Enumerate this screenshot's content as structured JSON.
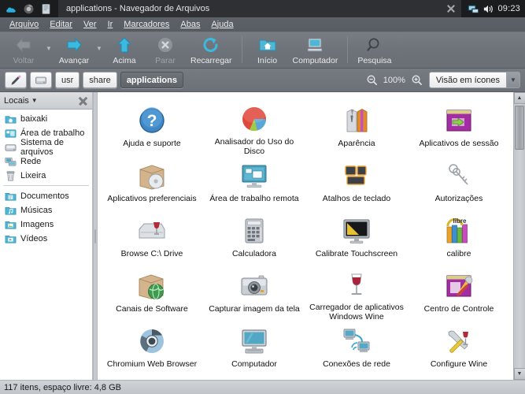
{
  "titlebar": {
    "launchers": [
      "cloud-icon",
      "browser-icon",
      "notes-icon"
    ],
    "window_title": "applications - Navegador de Arquivos",
    "close_label": "×",
    "tray": [
      "display-icon",
      "volume-icon"
    ],
    "clock": "09:23"
  },
  "menubar": {
    "items": [
      {
        "label": "Arquivo",
        "mnemonic": "A"
      },
      {
        "label": "Editar",
        "mnemonic": "E"
      },
      {
        "label": "Ver",
        "mnemonic": "V"
      },
      {
        "label": "Ir",
        "mnemonic": "I"
      },
      {
        "label": "Marcadores",
        "mnemonic": "M"
      },
      {
        "label": "Abas",
        "mnemonic": "b"
      },
      {
        "label": "Ajuda",
        "mnemonic": "u"
      }
    ]
  },
  "toolbar": {
    "buttons": [
      {
        "label": "Voltar",
        "icon": "arrow-left-icon",
        "enabled": false,
        "has_dropdown": true
      },
      {
        "label": "Avançar",
        "icon": "arrow-right-icon",
        "enabled": true,
        "has_dropdown": true
      },
      {
        "label": "Acima",
        "icon": "arrow-up-icon",
        "enabled": true,
        "has_dropdown": false
      },
      {
        "label": "Parar",
        "icon": "stop-icon",
        "enabled": false,
        "has_dropdown": false
      },
      {
        "label": "Recarregar",
        "icon": "reload-icon",
        "enabled": true,
        "has_dropdown": false
      },
      {
        "label": "Início",
        "icon": "home-folder-icon",
        "enabled": true,
        "has_dropdown": false
      },
      {
        "label": "Computador",
        "icon": "computer-icon",
        "enabled": true,
        "has_dropdown": false
      },
      {
        "label": "Pesquisa",
        "icon": "search-icon",
        "enabled": true,
        "has_dropdown": false
      }
    ]
  },
  "locationbar": {
    "edit_icon": "pencil-edit-icon",
    "root_icon": "harddrive-icon",
    "crumbs": [
      {
        "label": "usr",
        "current": false
      },
      {
        "label": "share",
        "current": false
      },
      {
        "label": "applications",
        "current": true
      }
    ],
    "zoom_out_icon": "zoom-out-icon",
    "zoom_level": "100%",
    "zoom_in_icon": "zoom-in-icon",
    "view_mode": "Visão em ícones",
    "view_caret": "▼"
  },
  "sidebar": {
    "title": "Locais",
    "caret": "▼",
    "close_label": "×",
    "groups": [
      {
        "items": [
          {
            "label": "baixaki",
            "icon": "home-folder-icon"
          },
          {
            "label": "Área de trabalho",
            "icon": "desktop-folder-icon"
          },
          {
            "label": "Sistema de arquivos",
            "icon": "harddrive-icon"
          },
          {
            "label": "Rede",
            "icon": "network-icon"
          },
          {
            "label": "Lixeira",
            "icon": "trash-icon"
          }
        ]
      },
      {
        "items": [
          {
            "label": "Documentos",
            "icon": "documents-folder-icon"
          },
          {
            "label": "Músicas",
            "icon": "music-folder-icon"
          },
          {
            "label": "Imagens",
            "icon": "pictures-folder-icon"
          },
          {
            "label": "Vídeos",
            "icon": "videos-folder-icon"
          }
        ]
      }
    ]
  },
  "files": [
    {
      "name": "Ajuda e suporte",
      "icon": "help-blue-question-icon"
    },
    {
      "name": "Analisador do Uso do Disco",
      "icon": "disk-usage-pie-icon"
    },
    {
      "name": "Aparência",
      "icon": "appearance-shirts-icon"
    },
    {
      "name": "Aplicativos de sessão",
      "icon": "session-apps-purple-icon"
    },
    {
      "name": "Aplicativos preferenciais",
      "icon": "preferred-apps-box-cd-icon"
    },
    {
      "name": "Área de trabalho remota",
      "icon": "remote-desktop-icon"
    },
    {
      "name": "Atalhos de teclado",
      "icon": "keyboard-shortcuts-icon"
    },
    {
      "name": "Autorizações",
      "icon": "keys-authorizations-icon"
    },
    {
      "name": "Browse C:\\ Drive",
      "icon": "wine-drive-icon"
    },
    {
      "name": "Calculadora",
      "icon": "calculator-icon"
    },
    {
      "name": "Calibrate Touchscreen",
      "icon": "touchscreen-calibrate-icon"
    },
    {
      "name": "calibre",
      "icon": "calibre-books-icon"
    },
    {
      "name": "Canais de Software",
      "icon": "software-channels-globe-icon"
    },
    {
      "name": "Capturar imagem da tela",
      "icon": "screenshot-camera-icon"
    },
    {
      "name": "Carregador de aplicativos Windows Wine",
      "icon": "wine-glass-icon"
    },
    {
      "name": "Centro de Controle",
      "icon": "control-center-icon"
    },
    {
      "name": "Chromium Web Browser",
      "icon": "chromium-icon"
    },
    {
      "name": "Computador",
      "icon": "computer-monitor-icon"
    },
    {
      "name": "Conexões de rede",
      "icon": "network-connections-icon"
    },
    {
      "name": "Configure Wine",
      "icon": "configure-wine-icon"
    }
  ],
  "scrollbar": {
    "up_arrow": "▲",
    "down_arrow": "▼"
  },
  "statusbar": {
    "text": "117 itens, espaço livre: 4,8 GB"
  }
}
